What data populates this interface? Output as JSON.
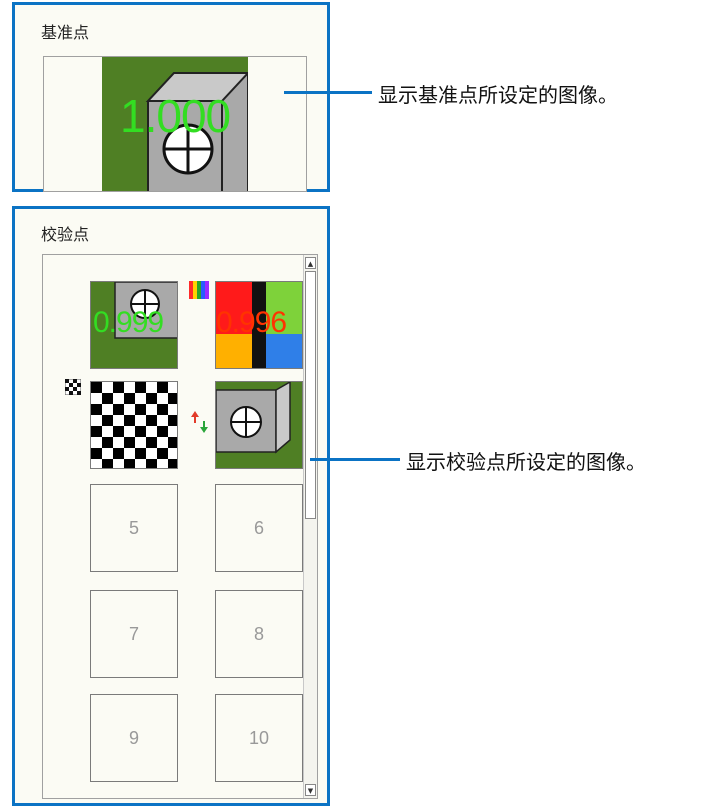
{
  "reference_panel": {
    "title": "基准点",
    "score": "1.000"
  },
  "check_panel": {
    "title": "校验点",
    "thumbnails": [
      {
        "score": "0.999"
      },
      {
        "score": "0.996"
      },
      {
        "score": ""
      },
      {
        "score": ""
      },
      {
        "number": "5"
      },
      {
        "number": "6"
      },
      {
        "number": "7"
      },
      {
        "number": "8"
      },
      {
        "number": "9"
      },
      {
        "number": "10"
      }
    ]
  },
  "callouts": {
    "reference": "显示基准点所设定的图像。",
    "check": "显示校验点所设定的图像。"
  },
  "colors": {
    "frame_blue": "#0b73c4",
    "score_green": "#33dd22",
    "score_red": "#ff3300",
    "board_green": "#4f7f24"
  },
  "icons": [
    "color-bars-icon",
    "checker-icon",
    "swap-arrows-icon"
  ]
}
